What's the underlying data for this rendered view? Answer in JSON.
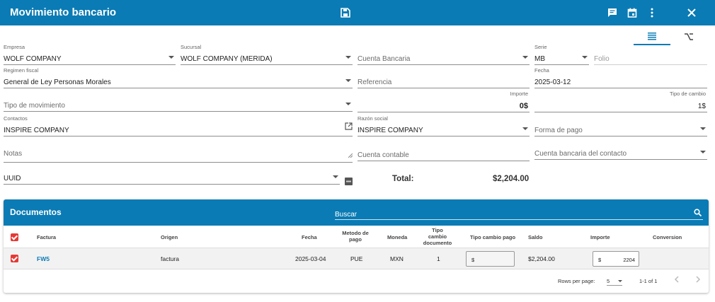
{
  "header": {
    "title": "Movimiento bancario",
    "icons": [
      "save-icon",
      "comment-icon",
      "calendar-icon",
      "more-vert-icon",
      "close-icon"
    ]
  },
  "view_tabs": [
    "list-view-icon",
    "option-key-icon"
  ],
  "form": {
    "empresa": {
      "label": "Empresa",
      "value": "WOLF COMPANY"
    },
    "sucursal": {
      "label": "Sucursal",
      "value": "WOLF COMPANY (MERIDA)"
    },
    "cuenta_bancaria": {
      "placeholder": "Cuenta Bancaria"
    },
    "serie": {
      "label": "Serie",
      "value": "MB"
    },
    "folio": {
      "placeholder": "Folio"
    },
    "regimen": {
      "label": "Regimen fiscal",
      "value": "General de Ley Personas Morales"
    },
    "referencia": {
      "placeholder": "Referencia"
    },
    "fecha": {
      "label": "Fecha",
      "value": "2025-03-12"
    },
    "tipo_movimiento": {
      "placeholder": "Tipo de movimiento"
    },
    "importe": {
      "label": "Importe",
      "value": "0$"
    },
    "tipo_cambio": {
      "label": "Tipo de cambio",
      "value": "1$"
    },
    "contactos": {
      "label": "Contactos",
      "value": "INSPIRE COMPANY"
    },
    "razon_social": {
      "label": "Razón social",
      "value": "INSPIRE COMPANY"
    },
    "forma_pago": {
      "placeholder": "Forma de pago"
    },
    "notas": {
      "placeholder": "Notas"
    },
    "cuenta_contable": {
      "placeholder": "Cuenta contable"
    },
    "cuenta_contacto": {
      "placeholder": "Cuenta bancaria del contacto"
    },
    "uuid": {
      "value": "UUID"
    },
    "total_label": "Total:",
    "total_value": "$2,204.00"
  },
  "documentos": {
    "title": "Documentos",
    "search_placeholder": "Buscar",
    "columns": {
      "factura": "Factura",
      "origen": "Origen",
      "fecha": "Fecha",
      "metodo": "Metodo de pago",
      "moneda": "Moneda",
      "tipo_doc": "Tipo cambio documento",
      "tipo_pago": "Tipo cambio pago",
      "saldo": "Saldo",
      "importe": "Importe",
      "conversion": "Conversion"
    },
    "rows": [
      {
        "factura": "FW5",
        "origen": "factura",
        "fecha": "2025-03-04",
        "metodo": "PUE",
        "moneda": "MXN",
        "tipo_doc": "1",
        "tipo_pago_prefix": "$",
        "saldo": "$2,204.00",
        "importe_prefix": "$",
        "importe": "2204"
      }
    ],
    "footer": {
      "rows_per_page_label": "Rows per page:",
      "rows_per_page": "5",
      "range": "1-1 of 1"
    }
  },
  "colors": {
    "primary": "#0a7bb4",
    "checkbox": "#e53935"
  }
}
